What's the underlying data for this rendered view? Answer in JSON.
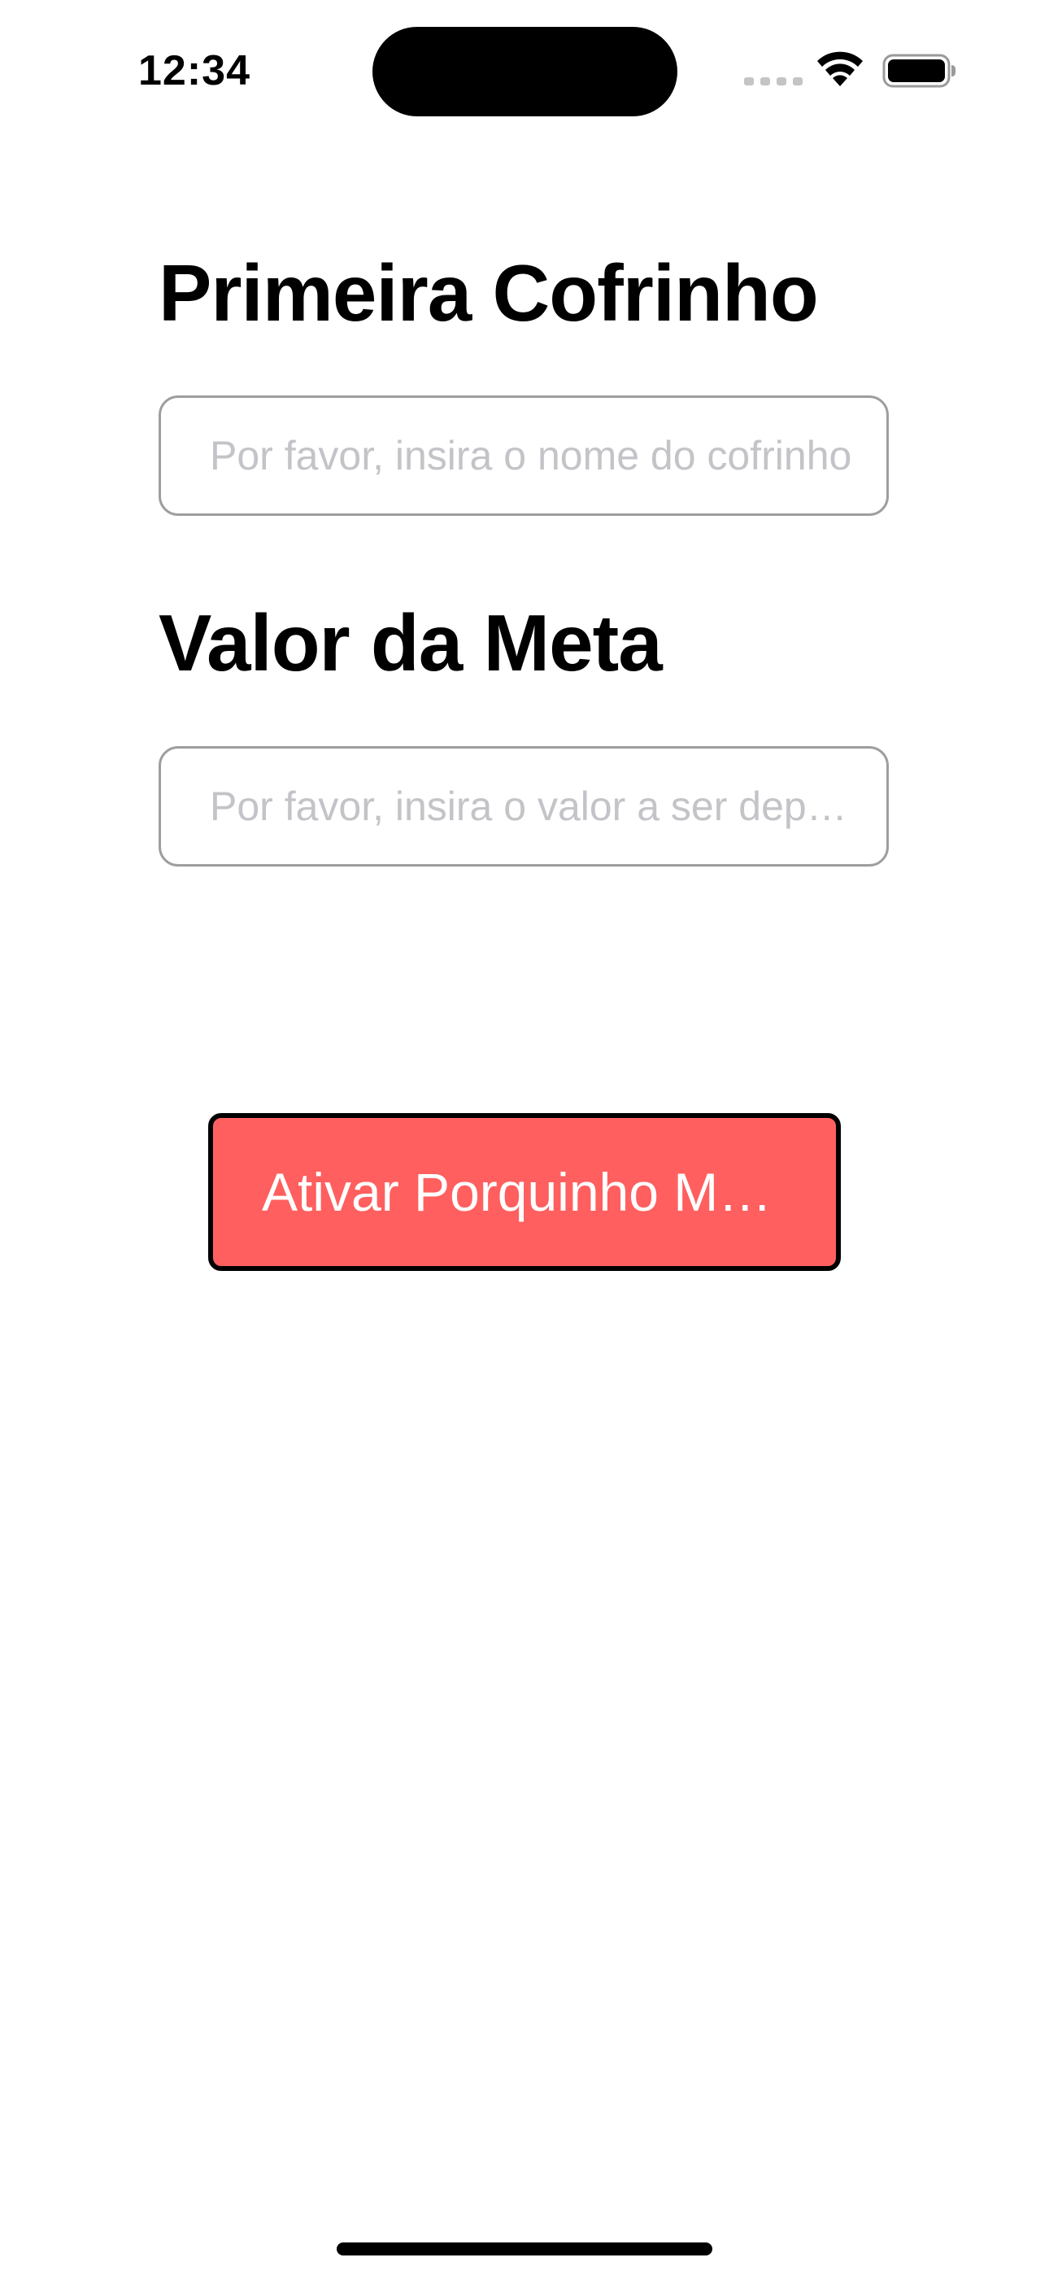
{
  "status_bar": {
    "time": "12:34",
    "icons": [
      "cellular-signal-icon",
      "wifi-icon",
      "battery-icon"
    ]
  },
  "form": {
    "name_section": {
      "title": "Primeira Cofrinho",
      "input_value": "",
      "input_placeholder": "Por favor, insira o nome do cofrinho"
    },
    "goal_section": {
      "title": "Valor da Meta",
      "input_value": "",
      "input_placeholder": "Por favor, insira o valor a ser depositado"
    }
  },
  "actions": {
    "activate_button_label": "Ativar Porquinho Mágico"
  },
  "colors": {
    "button_fill": "#ff5f5f",
    "button_border": "#000000",
    "input_border": "#9e9e9e",
    "placeholder": "#c3c3c8"
  }
}
